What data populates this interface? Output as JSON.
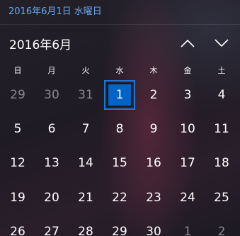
{
  "header": {
    "date_link": "2016年6月1日 水曜日"
  },
  "calendar": {
    "month_title": "2016年6月",
    "nav": {
      "up_icon": "chevron-up-icon",
      "down_icon": "chevron-down-icon"
    },
    "weekdays": [
      "日",
      "月",
      "火",
      "水",
      "木",
      "金",
      "土"
    ],
    "weeks": [
      [
        {
          "d": "29",
          "other": true
        },
        {
          "d": "30",
          "other": true
        },
        {
          "d": "31",
          "other": true
        },
        {
          "d": "1",
          "selected": true
        },
        {
          "d": "2"
        },
        {
          "d": "3"
        },
        {
          "d": "4"
        }
      ],
      [
        {
          "d": "5"
        },
        {
          "d": "6"
        },
        {
          "d": "7"
        },
        {
          "d": "8"
        },
        {
          "d": "9"
        },
        {
          "d": "10"
        },
        {
          "d": "11"
        }
      ],
      [
        {
          "d": "12"
        },
        {
          "d": "13"
        },
        {
          "d": "14"
        },
        {
          "d": "15"
        },
        {
          "d": "16"
        },
        {
          "d": "17"
        },
        {
          "d": "18"
        }
      ],
      [
        {
          "d": "19"
        },
        {
          "d": "20"
        },
        {
          "d": "21"
        },
        {
          "d": "22"
        },
        {
          "d": "23"
        },
        {
          "d": "24"
        },
        {
          "d": "25"
        }
      ],
      [
        {
          "d": "26"
        },
        {
          "d": "27"
        },
        {
          "d": "28"
        },
        {
          "d": "29"
        },
        {
          "d": "30"
        },
        {
          "d": "1",
          "other": true
        },
        {
          "d": "2",
          "other": true
        }
      ]
    ]
  },
  "colors": {
    "accent": "#0063c6",
    "link": "#6aa8ee",
    "other_month_text": "#8a8790"
  }
}
